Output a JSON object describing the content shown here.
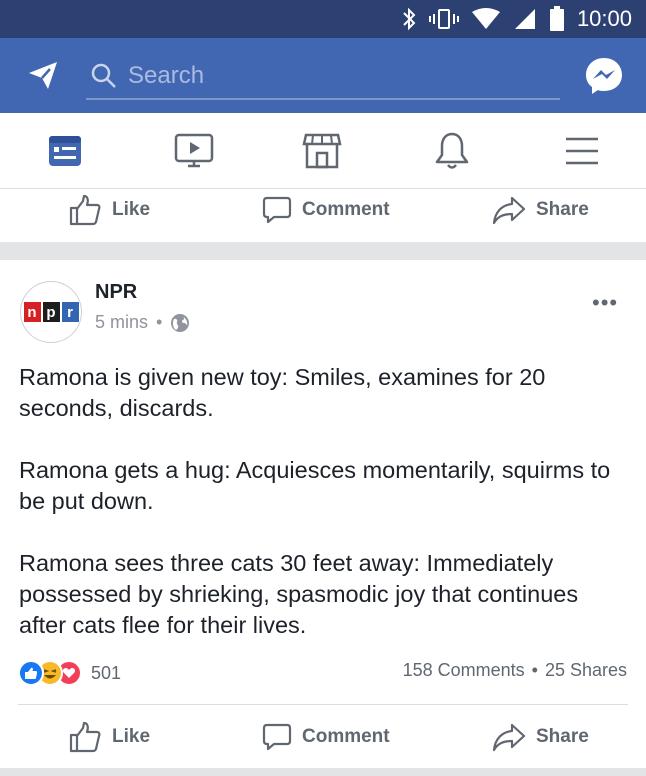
{
  "status_bar": {
    "time": "10:00"
  },
  "header": {
    "search_placeholder": "Search"
  },
  "nav": {
    "tabs": [
      {
        "name": "news-feed",
        "active": true
      },
      {
        "name": "watch",
        "active": false
      },
      {
        "name": "marketplace",
        "active": false
      },
      {
        "name": "notifications",
        "active": false
      },
      {
        "name": "menu",
        "active": false
      }
    ]
  },
  "actions": {
    "like": "Like",
    "comment": "Comment",
    "share": "Share"
  },
  "post": {
    "author": "NPR",
    "time": "5 mins",
    "logo": [
      "n",
      "p",
      "r"
    ],
    "paragraphs": [
      "Ramona is given new toy: Smiles, examines for 20 seconds, discards.",
      "Ramona gets a hug: Acquiesces momentarily, squirms to be put down.",
      "Ramona sees three cats 30 feet away: Immediately possessed by shrieking, spasmodic joy that continues after cats flee for their lives."
    ],
    "reaction_count": "501",
    "comments": "158 Comments",
    "shares": "25 Shares"
  },
  "colors": {
    "brand": "#4267b2",
    "status_bar": "#2c4171",
    "active_tab": "#4267b2",
    "icon_gray": "#606770"
  }
}
